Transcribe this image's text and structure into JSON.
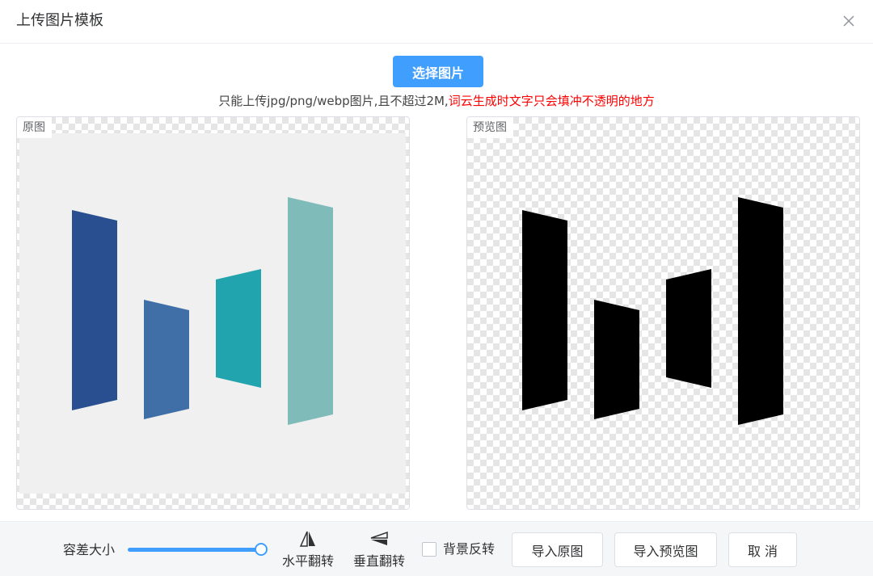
{
  "dialog": {
    "title": "上传图片模板",
    "close_icon": "close-icon"
  },
  "toolbar": {
    "select_label": "选择图片"
  },
  "hint": {
    "normal": "只能上传jpg/png/webp图片,且不超过2M,",
    "warning": "词云生成时文字只会填冲不透明的地方",
    "warning_color": "#ff0000"
  },
  "panels": {
    "original_label": "原图",
    "preview_label": "预览图",
    "original_bg": "#f0f0f0",
    "bar_colors": [
      "#2a4f91",
      "#3f6fa6",
      "#21a4ae",
      "#7fbbb8"
    ],
    "preview_fill": "#000000"
  },
  "controls": {
    "tolerance_label": "容差大小",
    "tolerance_value": 1.0,
    "flip_horizontal_label": "水平翻转",
    "flip_vertical_label": "垂直翻转",
    "background_invert_label": "背景反转",
    "background_invert_checked": false,
    "import_original_label": "导入原图",
    "import_preview_label": "导入预览图",
    "cancel_label": "取 消"
  },
  "colors": {
    "accent": "#409eff"
  }
}
